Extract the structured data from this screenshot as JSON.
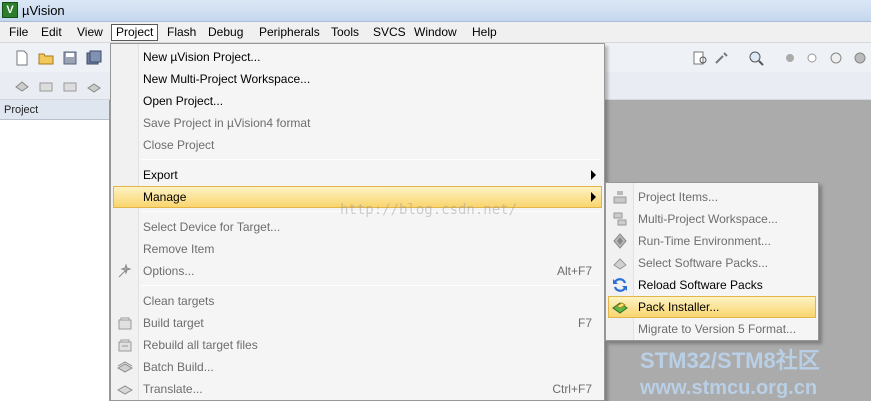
{
  "window": {
    "title": "µVision",
    "app_icon_letter": "V"
  },
  "menubar": {
    "items": [
      "File",
      "Edit",
      "View",
      "Project",
      "Flash",
      "Debug",
      "Peripherals",
      "Tools",
      "SVCS",
      "Window",
      "Help"
    ],
    "open_item": "Project"
  },
  "project_panel": {
    "title": "Project"
  },
  "project_menu": {
    "items": [
      {
        "label": "New µVision Project...",
        "shortcut": "",
        "enabled": true
      },
      {
        "label": "New Multi-Project Workspace...",
        "shortcut": "",
        "enabled": true
      },
      {
        "label": "Open Project...",
        "shortcut": "",
        "enabled": true
      },
      {
        "label": "Save Project in µVision4 format",
        "shortcut": "",
        "enabled": false
      },
      {
        "label": "Close Project",
        "shortcut": "",
        "enabled": false
      },
      {
        "label": "Export",
        "shortcut": "",
        "enabled": true,
        "submenu": true
      },
      {
        "label": "Manage",
        "shortcut": "",
        "enabled": true,
        "submenu": true,
        "highlighted": true
      },
      {
        "label": "Select Device for Target...",
        "shortcut": "",
        "enabled": false
      },
      {
        "label": "Remove Item",
        "shortcut": "",
        "enabled": false
      },
      {
        "label": "Options...",
        "shortcut": "Alt+F7",
        "enabled": false,
        "icon": "options-wand-icon"
      },
      {
        "label": "Clean targets",
        "shortcut": "",
        "enabled": false
      },
      {
        "label": "Build target",
        "shortcut": "F7",
        "enabled": false,
        "icon": "build-icon"
      },
      {
        "label": "Rebuild all target files",
        "shortcut": "",
        "enabled": false,
        "icon": "rebuild-icon"
      },
      {
        "label": "Batch Build...",
        "shortcut": "",
        "enabled": false,
        "icon": "batch-build-icon"
      },
      {
        "label": "Translate...",
        "shortcut": "Ctrl+F7",
        "enabled": false,
        "icon": "translate-icon"
      }
    ]
  },
  "manage_submenu": {
    "items": [
      {
        "label": "Project Items...",
        "enabled": false,
        "icon": "project-items-icon"
      },
      {
        "label": "Multi-Project Workspace...",
        "enabled": false,
        "icon": "workspace-icon"
      },
      {
        "label": "Run-Time Environment...",
        "enabled": false,
        "icon": "rte-icon"
      },
      {
        "label": "Select Software Packs...",
        "enabled": false,
        "icon": "select-packs-icon"
      },
      {
        "label": "Reload Software Packs",
        "enabled": true,
        "icon": "reload-icon"
      },
      {
        "label": "Pack Installer...",
        "enabled": true,
        "highlighted": true,
        "icon": "pack-installer-icon"
      },
      {
        "label": "Migrate to Version 5 Format...",
        "enabled": false
      }
    ]
  },
  "watermark": {
    "url": "http://blog.csdn.net/"
  },
  "brand": {
    "line1": "STM32/STM8社区",
    "line2": "www.stmcu.org.cn"
  },
  "colors": {
    "highlight": "#f9d56e",
    "workarea": "#ababab",
    "brand": "#b9cfe6"
  }
}
